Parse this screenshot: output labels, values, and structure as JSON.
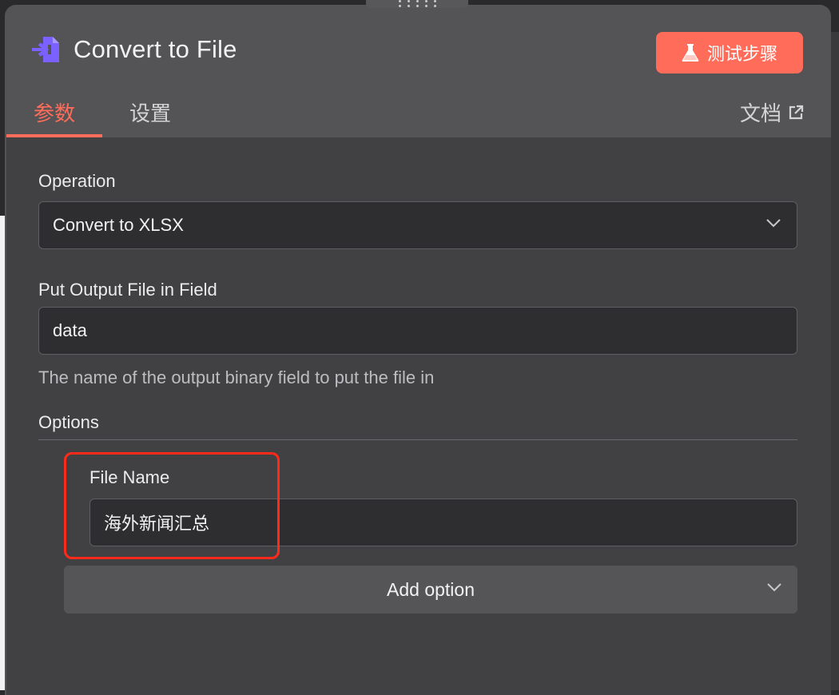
{
  "node": {
    "title": "Convert to File",
    "icon": "convert-file-icon",
    "test_button_label": "测试步骤",
    "test_button_icon": "flask-icon"
  },
  "tabs": [
    {
      "label": "参数",
      "active": true
    },
    {
      "label": "设置",
      "active": false
    }
  ],
  "docs": {
    "label": "文档",
    "icon": "external-link-icon"
  },
  "operation": {
    "label": "Operation",
    "value": "Convert to XLSX"
  },
  "output_field": {
    "label": "Put Output File in Field",
    "value": "data",
    "hint": "The name of the output binary field to put the file in"
  },
  "options": {
    "label": "Options",
    "file_name": {
      "label": "File Name",
      "value": "海外新闻汇总"
    },
    "add_option_label": "Add option"
  },
  "colors": {
    "accent": "#ff6d5a",
    "panel": "#545456",
    "body": "#414143",
    "input_bg": "#2e2e30",
    "highlight": "#ff2a1a",
    "icon_purple": "#7b61ff"
  }
}
